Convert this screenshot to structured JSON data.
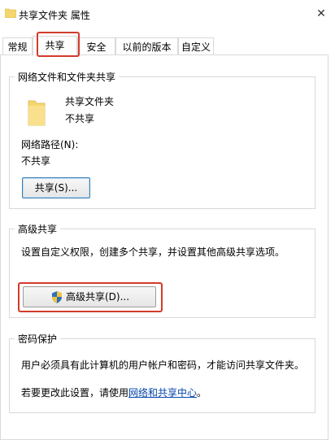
{
  "window": {
    "title": "共享文件夹 属性",
    "close_glyph": "✕"
  },
  "tabs": [
    {
      "label": "常规"
    },
    {
      "label": "共享",
      "active": true
    },
    {
      "label": "安全"
    },
    {
      "label": "以前的版本"
    },
    {
      "label": "自定义"
    }
  ],
  "network_section": {
    "title": "网络文件和文件夹共享",
    "folder_name": "共享文件夹",
    "folder_status": "不共享",
    "path_label": "网络路径(N):",
    "path_value": "不共享",
    "share_button": "共享(S)..."
  },
  "advanced_section": {
    "title": "高级共享",
    "description": "设置自定义权限，创建多个共享，并设置其他高级共享选项。",
    "button": "高级共享(D)..."
  },
  "password_section": {
    "title": "密码保护",
    "description": "用户必须具有此计算机的用户帐户和密码，才能访问共享文件夹。",
    "change_prefix": "若要更改此设置，请使用",
    "link": "网络和共享中心",
    "change_suffix": "。"
  },
  "colors": {
    "highlight": "#d33b2c",
    "link": "#0645ad",
    "folder": "#f5d66e"
  }
}
